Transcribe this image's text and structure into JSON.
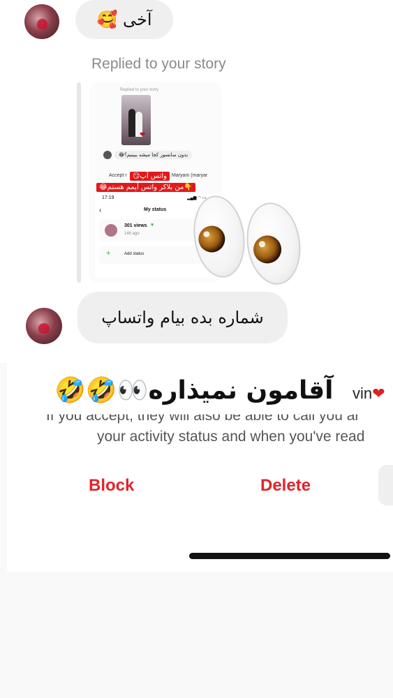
{
  "messages": {
    "first": {
      "text": "آخی 🥰"
    },
    "replied_label": "Replied to your story",
    "second": {
      "text": "شماره بده بیام واتساپ"
    }
  },
  "story_preview": {
    "replied_label": "Replied to your story",
    "reply_text": "بدون سانسور کجا میشه ببینیم؟😂",
    "accept_prefix": "Accept r",
    "accept_name": "Maryam (maryar",
    "tag_1": "واتس آپ😏",
    "tag_2": "👇من بلاکر واتس آپمم هستم😂",
    "time": "17:19",
    "header_title": "My status",
    "back_icon": "chevron-left-icon",
    "status_views": "301 views",
    "status_dot": "·",
    "status_heart": "♥",
    "status_ago": "14h ago",
    "add_status": "Add status"
  },
  "sticker": {
    "name": "eyes-emoji"
  },
  "request_panel": {
    "caption": "آقامون نمیذاره👀🤣🤣",
    "name_fragment": "vin",
    "heart": "❤",
    "info_line_1": "If you accept, they will also be able to call you ar",
    "info_line_2": "your activity status and when you've read",
    "block_label": "Block",
    "delete_label": "Delete"
  },
  "colors": {
    "danger": "#e0242b",
    "bubble": "#efefef",
    "muted_text": "#8a8a8a"
  }
}
